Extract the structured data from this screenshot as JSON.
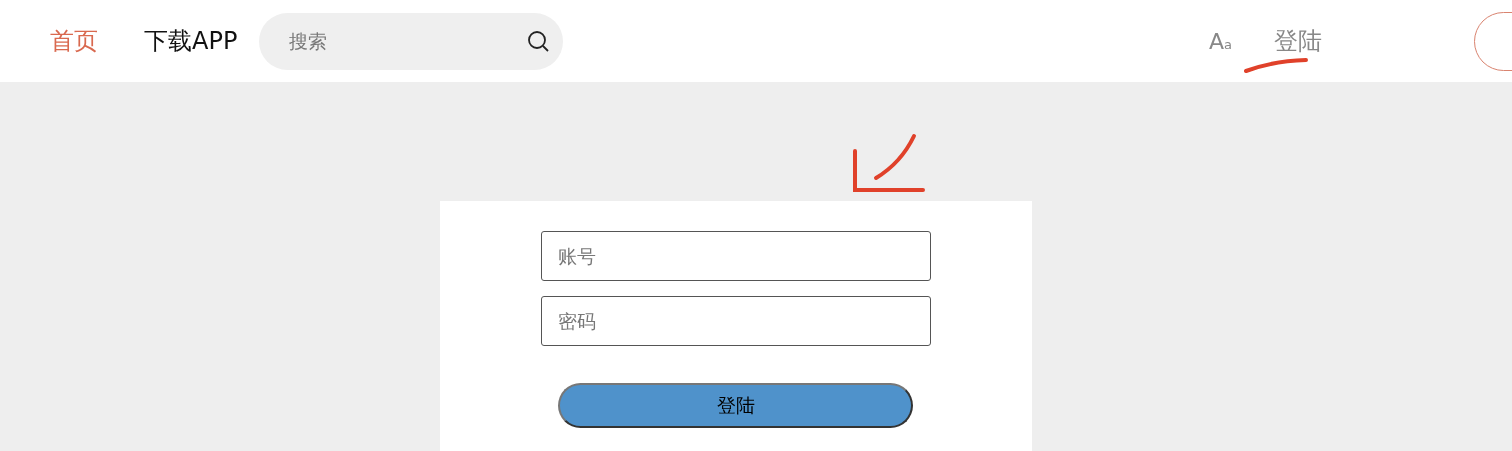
{
  "header": {
    "nav": [
      {
        "label": "首页",
        "selected": true
      },
      {
        "label": "下载APP",
        "selected": false
      }
    ],
    "search": {
      "placeholder": "搜索"
    },
    "font_toggle": "A$_{a}$",
    "login_link": "登陆"
  },
  "login_form": {
    "fields": [
      {
        "placeholder": "账号"
      },
      {
        "placeholder": "密码"
      }
    ],
    "submit": "登陆"
  }
}
